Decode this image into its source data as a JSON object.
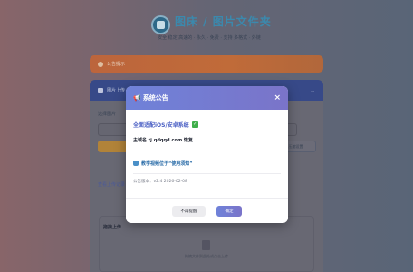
{
  "site": {
    "title": "图床 / 图片文件夹",
    "subtitle": "安全 稳定 高速的 · 永久 · 免费 · 支持 多格式 · 外链"
  },
  "background": {
    "notice_label": "公告提示",
    "section_header": "图片上传",
    "tag_label": "选择图片",
    "side_button_label": "压缩设置",
    "link_text": "查看上传记录",
    "upload_title": "拖拽上传",
    "upload_hint": "拖拽文件到此处或点击上传"
  },
  "modal": {
    "title": "系统公告",
    "close_label": "×",
    "line1": "全面适配iOS/安卓系统",
    "line2": "主域名 tj.qdqqd.com 恢复",
    "line3": "教学视频位于“使用须知”",
    "version": "公告版本：v2.4 2026-02-08",
    "dismiss_label": "不再提醒",
    "ok_label": "确定"
  },
  "icons": {
    "megaphone": "megaphone-icon",
    "check": "check-icon",
    "basket": "basket-icon",
    "close": "close-icon"
  },
  "colors": {
    "accent": "#6f82d9",
    "check_green": "#3fae4a",
    "link_blue": "#4a5fc4"
  }
}
